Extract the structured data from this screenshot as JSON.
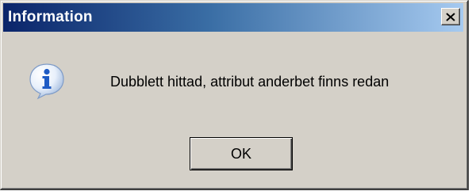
{
  "dialog": {
    "title": "Information",
    "message": "Dubblett hittad, attribut anderbet finns redan",
    "ok_label": "OK",
    "icon": "information-icon",
    "close_icon": "close-icon"
  },
  "colors": {
    "title_gradient_start": "#0a246a",
    "title_gradient_end": "#a6caf0",
    "face": "#d4d0c8",
    "icon_blue": "#2a63c5"
  }
}
